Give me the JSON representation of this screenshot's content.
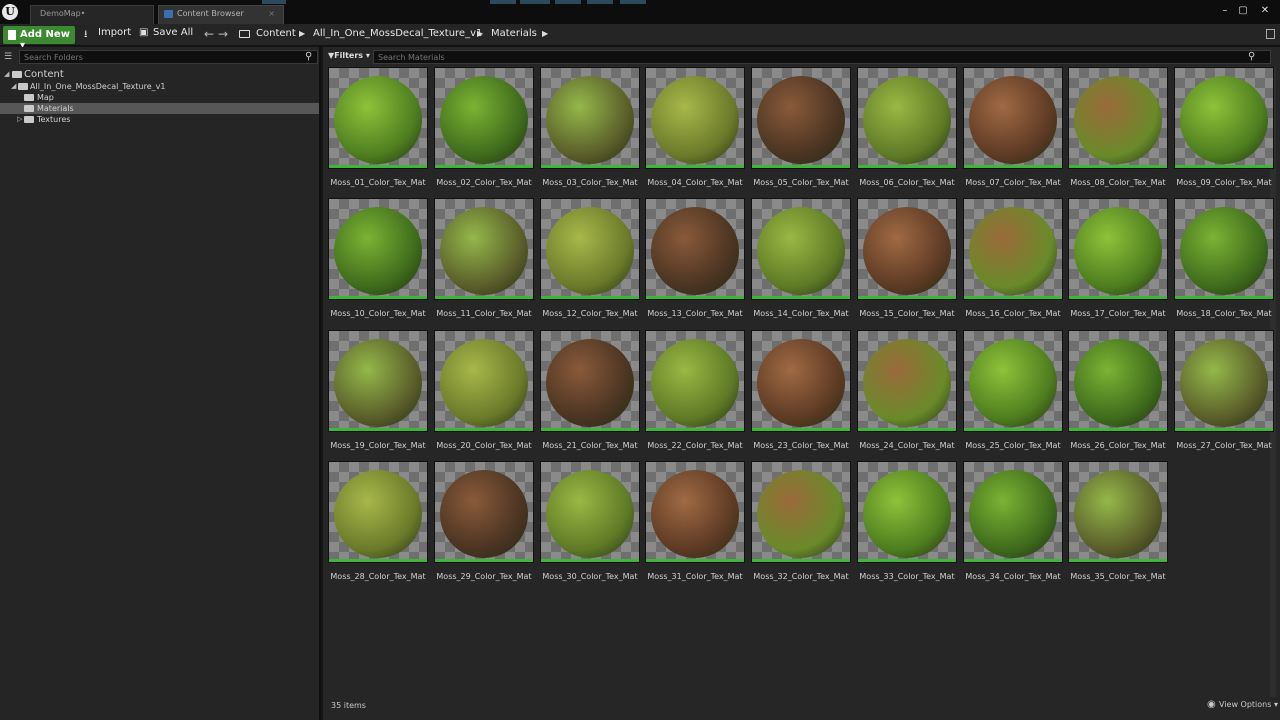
{
  "window": {
    "tabs": [
      {
        "label": "DemoMap•"
      },
      {
        "label": "Content Browser",
        "close": "×"
      }
    ],
    "controls": {
      "minimize": "–",
      "restore": "▢",
      "close": "✕"
    }
  },
  "toolbar": {
    "add_new_label": "Add New ▾",
    "import_label": "Import",
    "save_all_label": "Save All",
    "breadcrumbs": [
      "Content",
      "All_In_One_MossDecal_Texture_v1",
      "Materials"
    ]
  },
  "folders": {
    "search_placeholder": "Search Folders",
    "tree": {
      "root": "Content",
      "project": "All_In_One_MossDecal_Texture_v1",
      "children": [
        "Map",
        "Materials",
        "Textures"
      ],
      "selected": "Materials"
    }
  },
  "assets": {
    "filters_label": "Filters ▾",
    "search_placeholder": "Search Materials",
    "items": [
      {
        "name": "Moss_01_Color_Tex_Mat"
      },
      {
        "name": "Moss_02_Color_Tex_Mat"
      },
      {
        "name": "Moss_03_Color_Tex_Mat"
      },
      {
        "name": "Moss_04_Color_Tex_Mat"
      },
      {
        "name": "Moss_05_Color_Tex_Mat"
      },
      {
        "name": "Moss_06_Color_Tex_Mat"
      },
      {
        "name": "Moss_07_Color_Tex_Mat"
      },
      {
        "name": "Moss_08_Color_Tex_Mat"
      },
      {
        "name": "Moss_09_Color_Tex_Mat"
      },
      {
        "name": "Moss_10_Color_Tex_Mat"
      },
      {
        "name": "Moss_11_Color_Tex_Mat"
      },
      {
        "name": "Moss_12_Color_Tex_Mat"
      },
      {
        "name": "Moss_13_Color_Tex_Mat"
      },
      {
        "name": "Moss_14_Color_Tex_Mat"
      },
      {
        "name": "Moss_15_Color_Tex_Mat"
      },
      {
        "name": "Moss_16_Color_Tex_Mat"
      },
      {
        "name": "Moss_17_Color_Tex_Mat"
      },
      {
        "name": "Moss_18_Color_Tex_Mat"
      },
      {
        "name": "Moss_19_Color_Tex_Mat"
      },
      {
        "name": "Moss_20_Color_Tex_Mat"
      },
      {
        "name": "Moss_21_Color_Tex_Mat"
      },
      {
        "name": "Moss_22_Color_Tex_Mat"
      },
      {
        "name": "Moss_23_Color_Tex_Mat"
      },
      {
        "name": "Moss_24_Color_Tex_Mat"
      },
      {
        "name": "Moss_25_Color_Tex_Mat"
      },
      {
        "name": "Moss_26_Color_Tex_Mat"
      },
      {
        "name": "Moss_27_Color_Tex_Mat"
      },
      {
        "name": "Moss_28_Color_Tex_Mat"
      },
      {
        "name": "Moss_29_Color_Tex_Mat"
      },
      {
        "name": "Moss_30_Color_Tex_Mat"
      },
      {
        "name": "Moss_31_Color_Tex_Mat"
      },
      {
        "name": "Moss_32_Color_Tex_Mat"
      },
      {
        "name": "Moss_33_Color_Tex_Mat"
      },
      {
        "name": "Moss_34_Color_Tex_Mat"
      },
      {
        "name": "Moss_35_Color_Tex_Mat"
      }
    ],
    "count_label": "35 items",
    "view_options_label": "View Options ▾"
  },
  "colors": {
    "accent_green": "#3b8a32",
    "asset_bar": "#3fb53a",
    "selection": "#575757"
  }
}
